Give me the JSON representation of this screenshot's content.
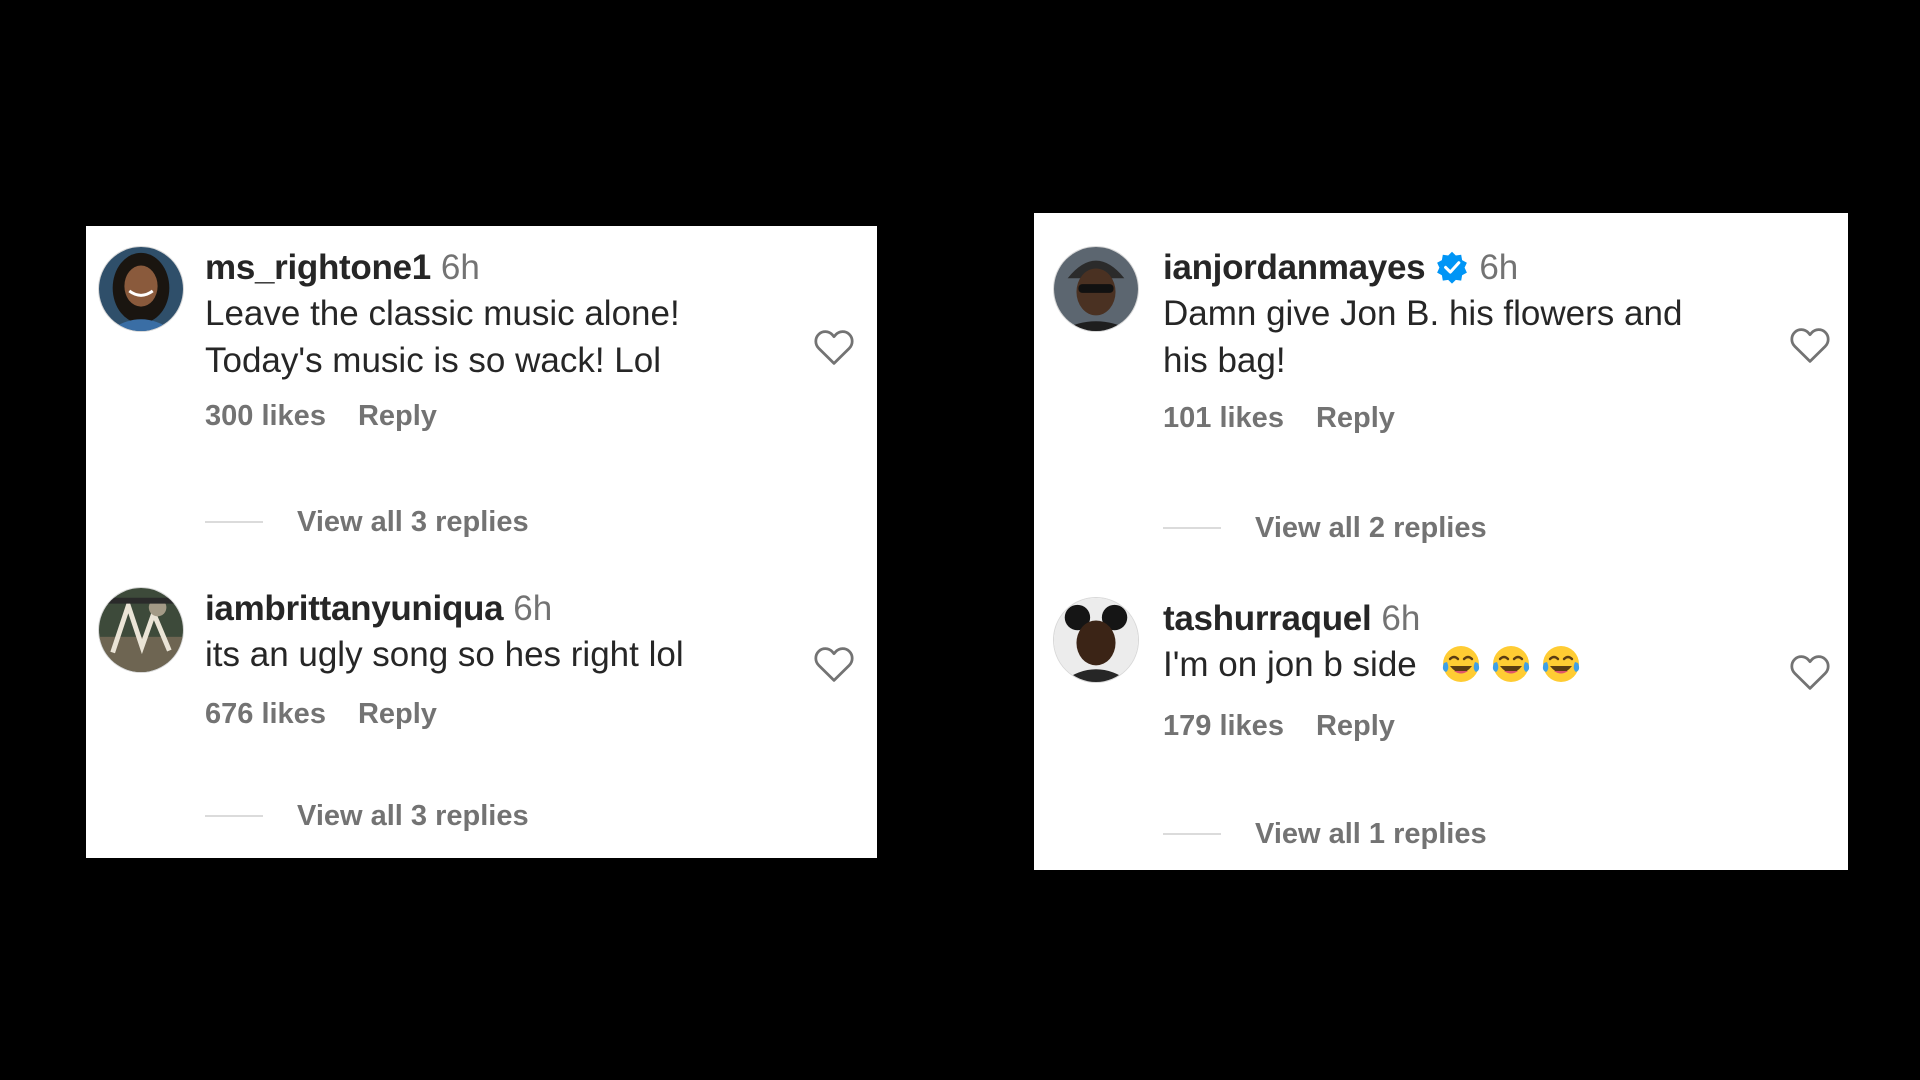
{
  "panels": [
    {
      "comments": [
        {
          "username": "ms_rightone1",
          "time": "6h",
          "verified": false,
          "text_lines": [
            "Leave the classic music alone!",
            "Today's music is so wack! Lol"
          ],
          "likes": "300 likes",
          "reply_label": "Reply",
          "view_replies": "View all 3 replies"
        },
        {
          "username": "iambrittanyuniqua",
          "time": "6h",
          "verified": false,
          "text_lines": [
            "its an ugly song so hes right lol"
          ],
          "likes": "676 likes",
          "reply_label": "Reply",
          "view_replies": "View all 3 replies"
        }
      ]
    },
    {
      "comments": [
        {
          "username": "ianjordanmayes",
          "time": "6h",
          "verified": true,
          "text_lines": [
            "Damn give Jon B. his flowers and",
            "his bag!"
          ],
          "likes": "101 likes",
          "reply_label": "Reply",
          "view_replies": "View all 2 replies"
        },
        {
          "username": "tashurraquel",
          "time": "6h",
          "verified": false,
          "text_lines": [
            "I'm on jon b side"
          ],
          "emojis": [
            "face-with-tears-of-joy",
            "face-with-tears-of-joy",
            "face-with-tears-of-joy"
          ],
          "likes": "179 likes",
          "reply_label": "Reply",
          "view_replies": "View all 1 replies"
        }
      ]
    }
  ],
  "icons": {
    "like": "heart-outline-icon",
    "verified": "verified-badge-icon",
    "emoji": "face-with-tears-of-joy"
  },
  "colors": {
    "background": "#000000",
    "card": "#ffffff",
    "text_primary": "#262626",
    "text_secondary": "#737373",
    "verified_blue": "#0095f6",
    "divider": "#dbdbdb"
  }
}
